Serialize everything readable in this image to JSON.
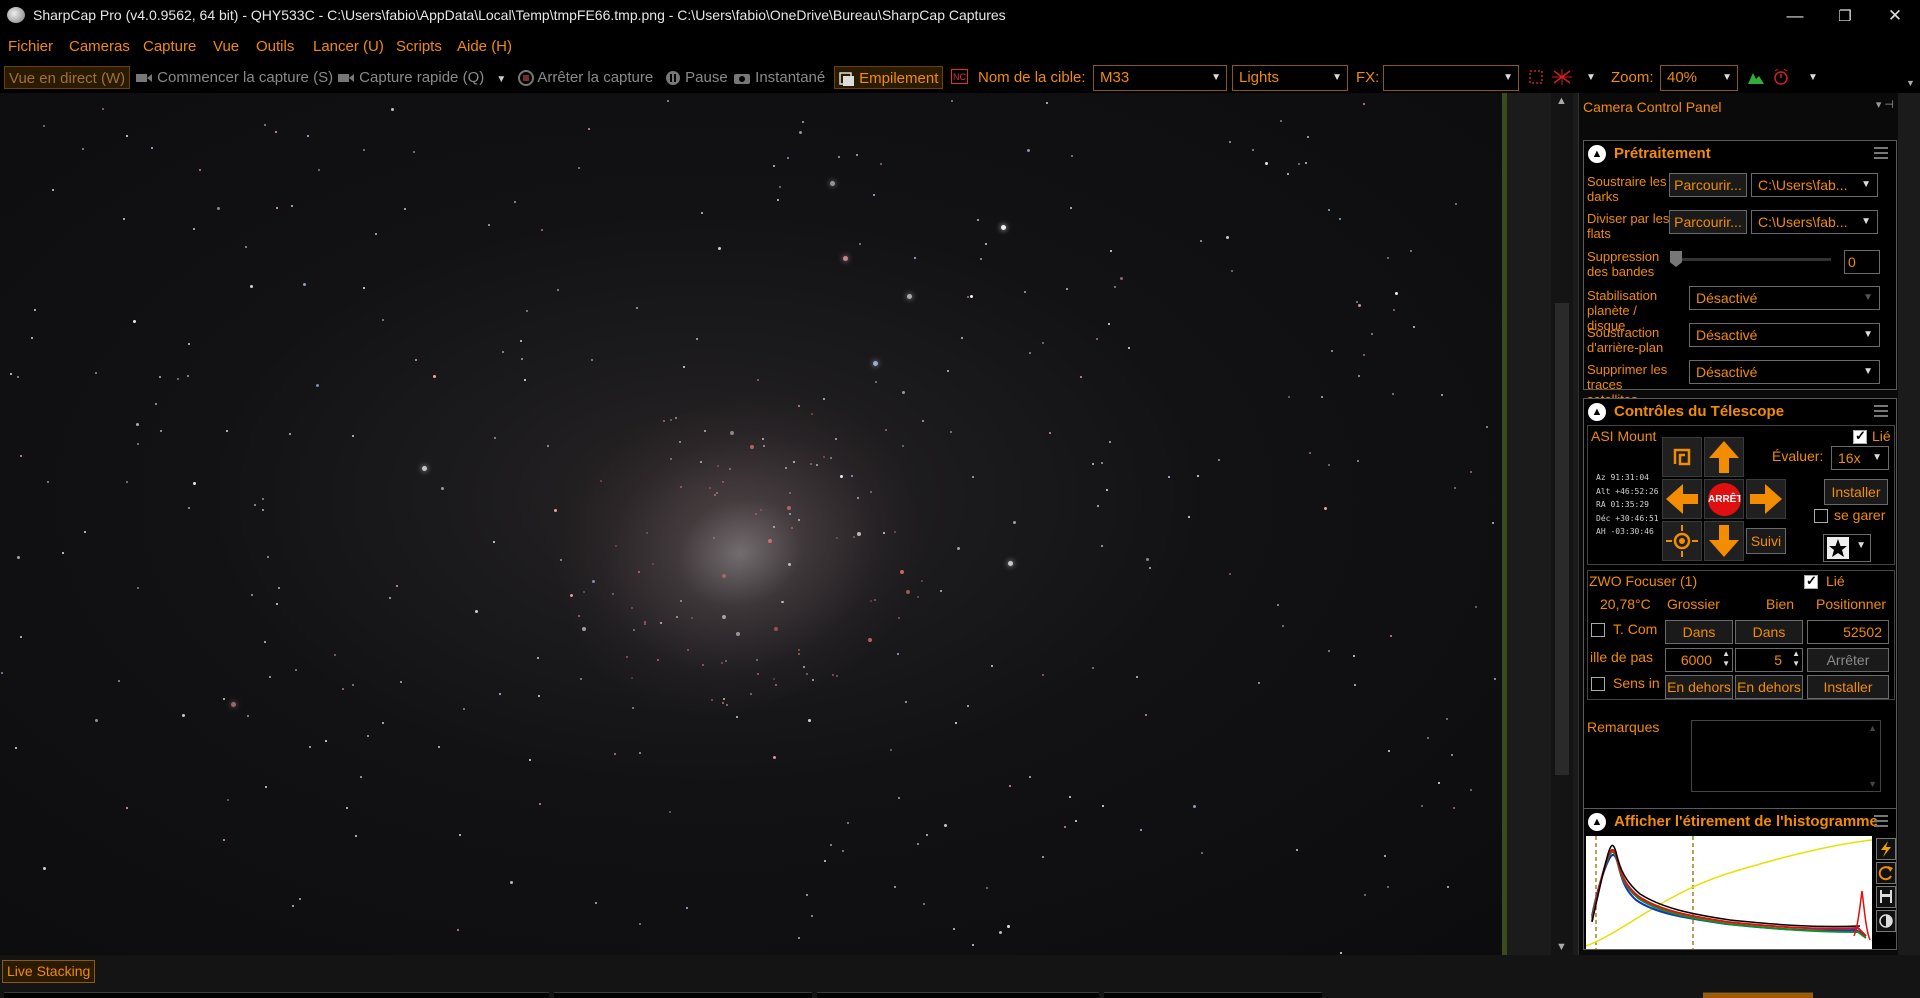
{
  "window": {
    "title": "SharpCap Pro (v4.0.9562, 64 bit) - QHY533C - C:\\Users\\fabio\\AppData\\Local\\Temp\\tmpFE66.tmp.png - C:\\Users\\fabio\\OneDrive\\Bureau\\SharpCap Captures",
    "minimize": "—",
    "maximize": "❐",
    "close": "✕"
  },
  "menu": [
    "Fichier",
    "Cameras",
    "Capture",
    "Vue",
    "Outils",
    "Lancer (U)",
    "Scripts",
    "Aide (H)"
  ],
  "toolbar": {
    "live_view": "Vue en direct (W)",
    "start_capture": "Commencer la capture (S)",
    "quick_capture": "Capture rapide (Q)",
    "stop_capture": "Arrêter la capture",
    "pause": "Pause",
    "snapshot": "Instantané",
    "stacking": "Empilement",
    "target_label": "Nom de la cible:",
    "target_value": "M33",
    "frame_type": "Lights",
    "fx_label": "FX:",
    "fx_value": "",
    "zoom_label": "Zoom:",
    "zoom_value": "40%"
  },
  "panel": {
    "title": "Camera Control Panel",
    "preprocessing": {
      "title": "Prétraitement",
      "darks_label": "Soustraire les darks",
      "darks_browse": "Parcourir...",
      "darks_path": "C:\\Users\\fab...",
      "flats_label": "Diviser par les flats",
      "flats_browse": "Parcourir...",
      "flats_path": "C:\\Users\\fab...",
      "banding_label": "Suppression des bandes",
      "banding_value": "0",
      "stabilization_label": "Stabilisation planète / disque",
      "stabilization_value": "Désactivé",
      "background_label": "Soustraction d'arrière-plan",
      "background_value": "Désactivé",
      "satellite_label": "Supprimer les traces satellites",
      "satellite_value": "Désactivé"
    },
    "telescope": {
      "title": "Contrôles du Télescope",
      "mount_name": "ASI Mount",
      "linked_label": "Lié",
      "linked": true,
      "coords": [
        "Az   91:31:04",
        "Alt  +46:52:26",
        "RA   01:35:29",
        "Déc  +30:46:51",
        "AH   -03:30:46"
      ],
      "rate_label": "Évaluer:",
      "rate_value": "16x",
      "stop_label": "ARRÊTE",
      "install_label": "Installer",
      "park_label": "se garer",
      "tracking_label": "Suivi"
    },
    "focuser": {
      "name": "ZWO Focuser (1)",
      "linked_label": "Lié",
      "temperature": "20,78°C",
      "coarse_label": "Grossier",
      "fine_label": "Bien",
      "position_label": "Positionner",
      "temp_comp_label": "T. Com",
      "coarse_in": "Dans",
      "fine_in": "Dans",
      "position_value": "52502",
      "step_label": "ille de pas",
      "coarse_step": "6000",
      "fine_step": "5",
      "stop_label": "Arrêter",
      "reverse_label": "Sens in",
      "coarse_out": "En dehors",
      "fine_out": "En dehors",
      "install_label": "Installer"
    },
    "notes_label": "Remarques",
    "histogram": {
      "title": "Afficher l'étirement de l'histogramme"
    }
  },
  "status": {
    "live_stacking_tab": "Live Stacking"
  }
}
